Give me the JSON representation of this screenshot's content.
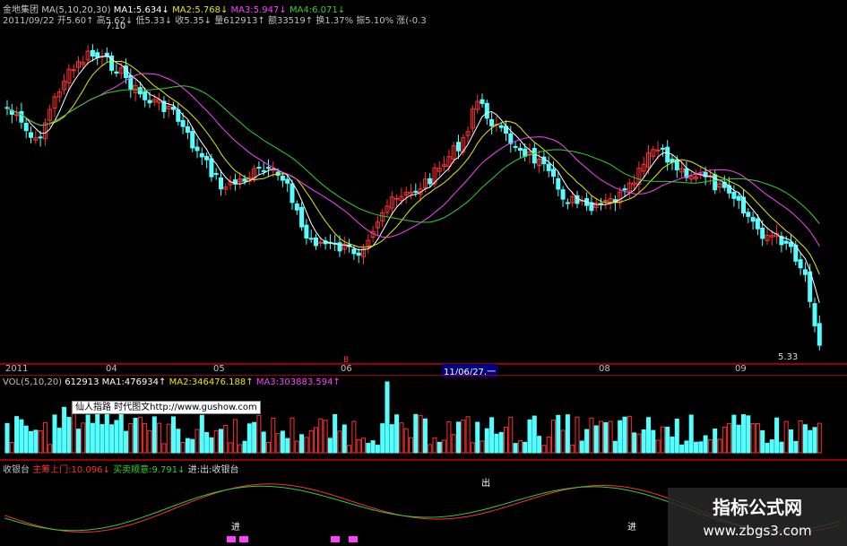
{
  "header": {
    "stock_name": "金地集团",
    "ma_spec": "MA(5,10,20,30)",
    "ma1": "MA1:5.634↓",
    "ma2": "MA2:5.768↓",
    "ma3": "MA3:5.947↓",
    "ma4": "MA4:6.071↓",
    "date": "2011/09/22",
    "open": "开5.60↑",
    "high": "高5.62↓",
    "low": "低5.33↓",
    "close": "收5.35↓",
    "volume": "量612913↑",
    "amount": "额33519↑",
    "turnover": "换1.37%",
    "amplitude": "振5.10%",
    "change": "涨(-0.3"
  },
  "price_panel": {
    "high_label": "7.10",
    "low_label": "5.33",
    "marker_red": "B"
  },
  "x_axis": {
    "labels": [
      "2011",
      "04",
      "05",
      "06",
      "08",
      "09"
    ],
    "cursor_date": "11/06/27,一"
  },
  "vol_header": {
    "spec": "VOL(5,10,20)",
    "value": "612913",
    "ma1": "MA1:476934↑",
    "ma2": "MA2:346476.188↑",
    "ma3": "MA3:303883.594↑"
  },
  "tooltip": "仙人指路  时代图文http://www.gushow.com",
  "indicator_header": {
    "name": "收银台",
    "line1": "主筹上门:10.096↓",
    "line2": "买卖顺意:9.791↓",
    "line3": "进:出:收银台"
  },
  "indicator_labels": {
    "in_1": "进",
    "in_2": "进",
    "out_1": "出"
  },
  "watermark": {
    "title": "指标公式网",
    "url": "www.zbgs3.com"
  },
  "colors": {
    "up": "#ff3030",
    "down": "#54ffff",
    "ma1": "#ffffff",
    "ma2": "#e8e800",
    "ma3": "#ff40ff",
    "ma4": "#30d030",
    "separator": "#9a0000"
  },
  "chart_data": {
    "type": "candlestick",
    "price_min_shown": 5.33,
    "price_max_shown": 7.1,
    "last": {
      "date": "2011/09/22",
      "open": 5.6,
      "high": 5.62,
      "low": 5.33,
      "close": 5.35,
      "volume": 612913
    },
    "moving_averages": {
      "MA1": 5.634,
      "MA2": 5.768,
      "MA3": 5.947,
      "MA4": 6.071
    },
    "volume_moving_averages": {
      "MA1": 476934,
      "MA2": 346476.188,
      "MA3": 303883.594
    },
    "indicator_values": {
      "主筹上门": 10.096,
      "买卖顺意": 9.791
    }
  }
}
